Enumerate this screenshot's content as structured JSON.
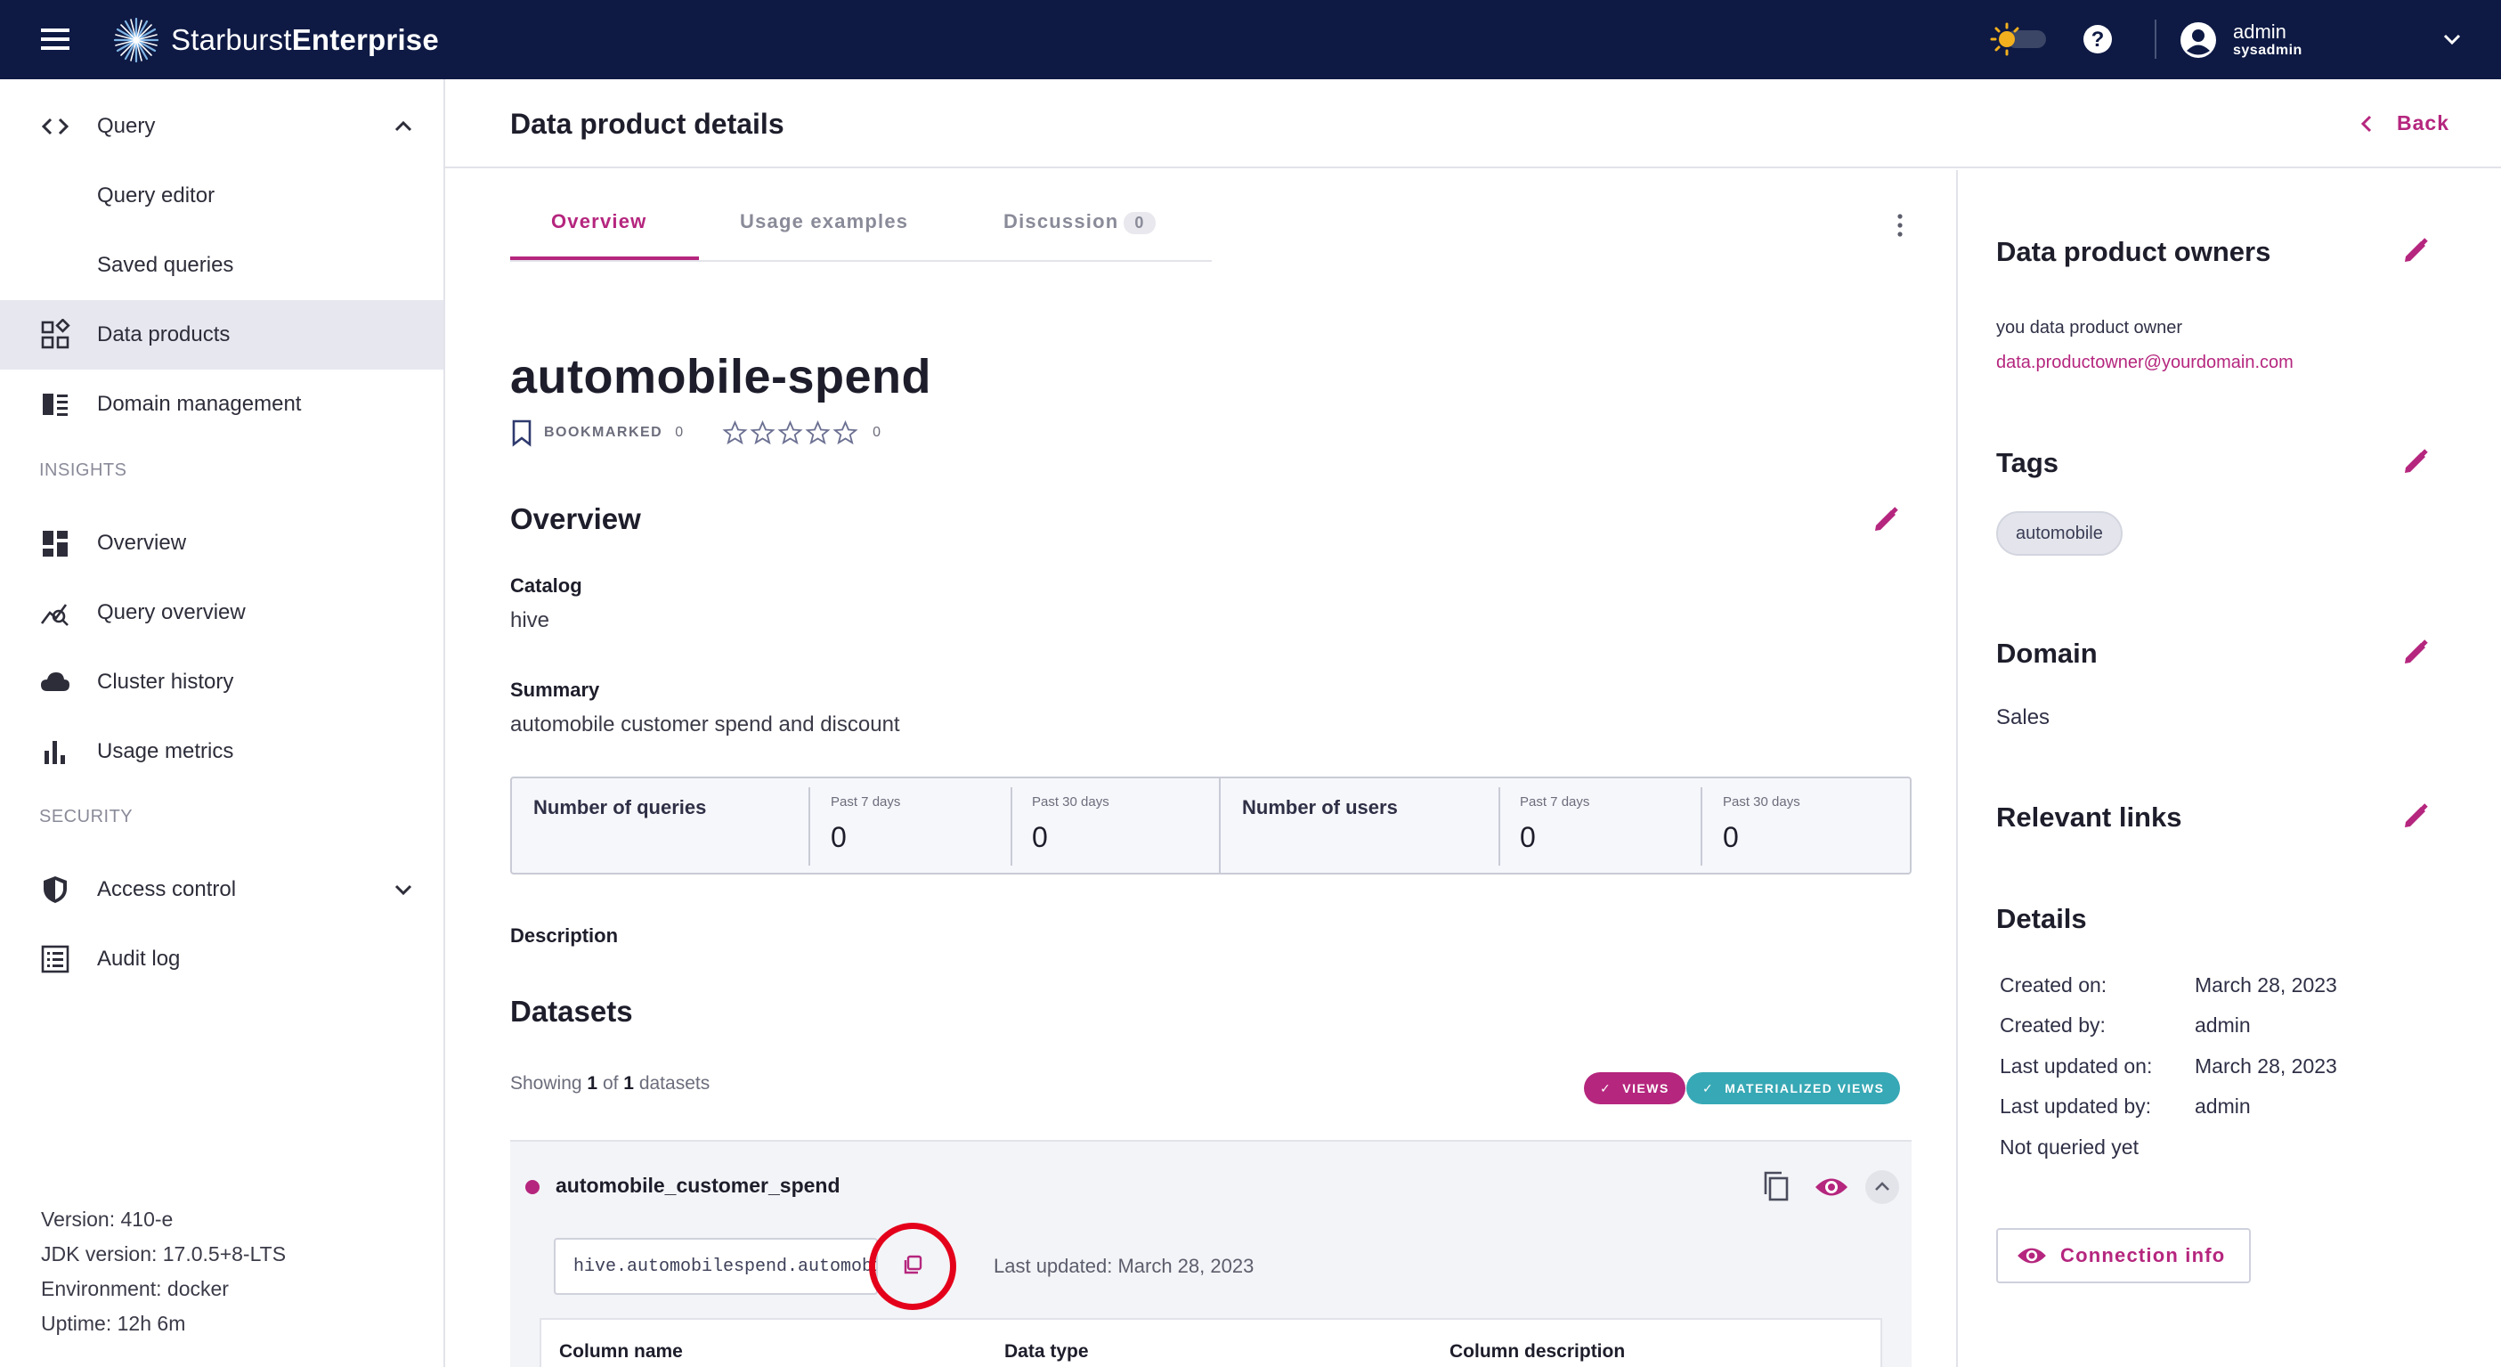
{
  "app": {
    "logo_light": "Starburst",
    "logo_bold": "Enterprise",
    "user_name": "admin",
    "user_role": "sysadmin"
  },
  "sidebar": {
    "items": [
      {
        "label": "Query",
        "icon": "code-icon"
      },
      {
        "label": "Query editor"
      },
      {
        "label": "Saved queries"
      },
      {
        "label": "Data products",
        "icon": "data-products-icon",
        "active": true
      },
      {
        "label": "Domain management",
        "icon": "domain-icon"
      },
      {
        "label": "Overview",
        "icon": "dashboard-icon"
      },
      {
        "label": "Query overview",
        "icon": "query-insights-icon"
      },
      {
        "label": "Cluster history",
        "icon": "cloud-icon"
      },
      {
        "label": "Usage metrics",
        "icon": "bar-chart-icon"
      },
      {
        "label": "Access control",
        "icon": "shield-icon"
      },
      {
        "label": "Audit log",
        "icon": "list-icon"
      }
    ],
    "sections": {
      "insights": "INSIGHTS",
      "security": "SECURITY"
    },
    "version": "Version: 410-e",
    "jdk": "JDK version: 17.0.5+8-LTS",
    "environment": "Environment: docker",
    "uptime": "Uptime: 12h 6m"
  },
  "header": {
    "title": "Data product details",
    "back": "Back"
  },
  "tabs": [
    {
      "label": "Overview",
      "active": true
    },
    {
      "label": "Usage examples"
    },
    {
      "label": "Discussion",
      "count": "0"
    }
  ],
  "product": {
    "name": "automobile-spend",
    "bookmarked_label": "BOOKMARKED",
    "bookmarked_count": "0",
    "rating_count": "0",
    "rating_value": 0
  },
  "overview": {
    "heading": "Overview",
    "catalog_label": "Catalog",
    "catalog_value": "hive",
    "summary_label": "Summary",
    "summary_value": "automobile customer spend and discount",
    "description_label": "Description"
  },
  "stats": {
    "queries_label": "Number of queries",
    "users_label": "Number of users",
    "past7_label": "Past 7 days",
    "past30_label": "Past 30 days",
    "queries_7": "0",
    "queries_30": "0",
    "users_7": "0",
    "users_30": "0"
  },
  "datasets": {
    "heading": "Datasets",
    "showing_prefix": "Showing",
    "showing_count": "1",
    "showing_of": "of",
    "showing_total": "1",
    "showing_suffix": "datasets",
    "filter_views": "VIEWS",
    "filter_materialized": "MATERIALIZED VIEWS",
    "items": [
      {
        "name": "automobile_customer_spend",
        "path": "hive.automobilespend.automobile_customer_spend",
        "updated": "Last updated: March 28, 2023"
      }
    ],
    "columns": [
      "Column name",
      "Data type",
      "Column description"
    ]
  },
  "right_panel": {
    "owners_heading": "Data product owners",
    "owner_name": "you data product owner",
    "owner_email": "data.productowner@yourdomain.com",
    "tags_heading": "Tags",
    "tags": [
      "automobile"
    ],
    "domain_heading": "Domain",
    "domain_value": "Sales",
    "links_heading": "Relevant links",
    "details_heading": "Details",
    "details": [
      {
        "label": "Created on:",
        "value": "March 28, 2023"
      },
      {
        "label": "Created by:",
        "value": "admin"
      },
      {
        "label": "Last updated on:",
        "value": "March 28, 2023"
      },
      {
        "label": "Last updated by:",
        "value": "admin"
      },
      {
        "label": "Not queried yet",
        "value": ""
      }
    ],
    "connection_button": "Connection info"
  },
  "colors": {
    "topbar": "#0e1a44",
    "accent": "#b5267e",
    "teal": "#37a8b5",
    "highlight": "#e4001a"
  }
}
